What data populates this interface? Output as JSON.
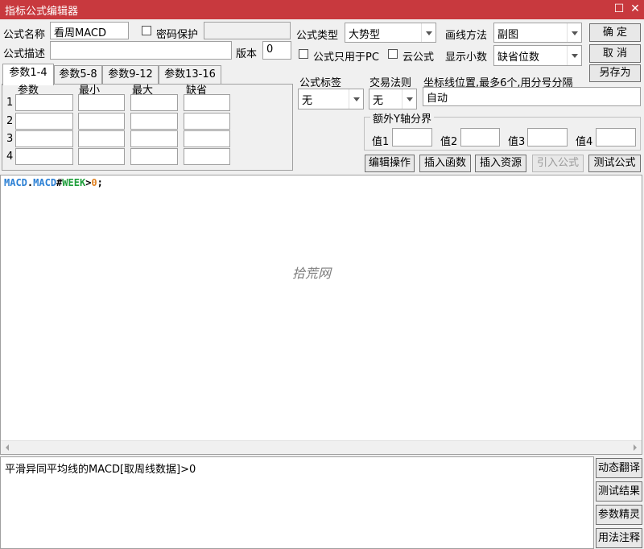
{
  "window": {
    "title": "指标公式编辑器",
    "restore_glyph": "☐",
    "close_glyph": "✕"
  },
  "form": {
    "name_label": "公式名称",
    "name_value": "看周MACD",
    "password_label": "密码保护",
    "password_value": "",
    "desc_label": "公式描述",
    "desc_value": "",
    "version_label": "版本",
    "version_value": "0",
    "type_label": "公式类型",
    "type_value": "大势型",
    "draw_label": "画线方法",
    "draw_value": "副图",
    "pc_only_label": "公式只用于PC",
    "cloud_label": "云公式",
    "decimals_label": "显示小数",
    "decimals_value": "缺省位数",
    "tag_label": "公式标签",
    "tag_value": "无",
    "trade_label": "交易法则",
    "trade_value": "无",
    "coord_label": "坐标线位置,最多6个,用分号分隔",
    "coord_value": "自动",
    "extra_y_label": "额外Y轴分界",
    "val1_label": "值1",
    "val2_label": "值2",
    "val3_label": "值3",
    "val4_label": "值4"
  },
  "buttons": {
    "ok": "确  定",
    "cancel": "取  消",
    "save_as": "另存为",
    "edit_ops": "编辑操作",
    "insert_func": "插入函数",
    "insert_res": "插入资源",
    "import_formula": "引入公式",
    "test_formula": "测试公式"
  },
  "tabs": [
    "参数1-4",
    "参数5-8",
    "参数9-12",
    "参数13-16"
  ],
  "param_table": {
    "headers": [
      "参数",
      "最小",
      "最大",
      "缺省"
    ],
    "rows": [
      "1",
      "2",
      "3",
      "4"
    ]
  },
  "editor": {
    "code_fn": "MACD",
    "code_dot": ".",
    "code_field": "MACD",
    "code_hash": "#",
    "code_kw": "WEEK",
    "code_gt": ">",
    "code_num": "0",
    "code_end": ";",
    "watermark": "拾荒网"
  },
  "description": {
    "text": "平滑异同平均线的MACD[取周线数据]>0"
  },
  "side_buttons": [
    "动态翻译",
    "测试结果",
    "参数精灵",
    "用法注释"
  ],
  "colors": {
    "titlebar": "#c8393e",
    "code_function": "#2a7fd4",
    "code_keyword": "#1e9e3a",
    "code_number": "#e08020"
  }
}
